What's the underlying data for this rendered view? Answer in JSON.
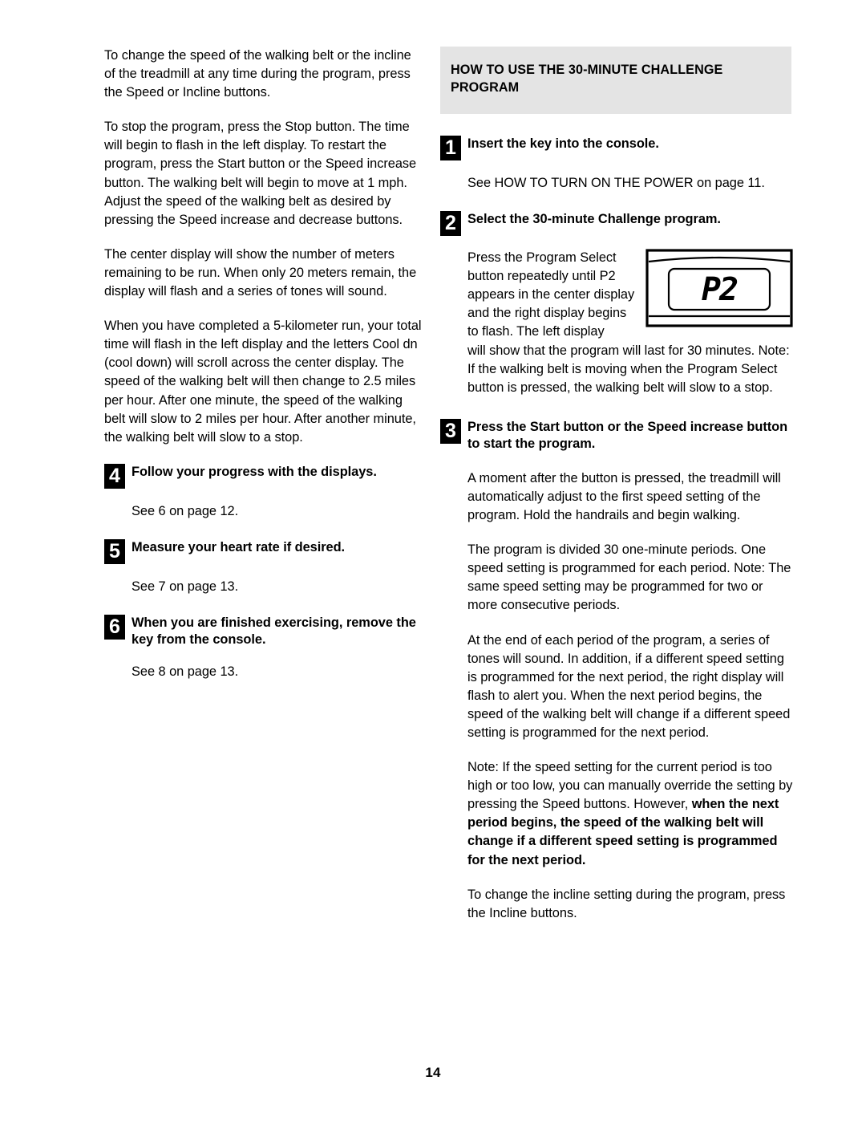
{
  "page": {
    "number": "14"
  },
  "left_column": {
    "paragraphs": [
      "To change the speed of the walking belt or the incline of the treadmill at any time during the program, press the Speed or Incline buttons.",
      "To stop the program, press the Stop button. The time will begin to flash in the left display. To restart the program, press the Start button or the Speed increase button. The walking belt will begin to move at 1 mph. Adjust the speed of the walking belt as desired by pressing the Speed increase and decrease buttons.",
      "The center display will show the number of meters remaining to be run. When only 20 meters remain, the display will flash and a series of tones will sound.",
      "When you have completed a 5-kilometer run, your total time will flash in the left display and the letters  Cool dn  (cool down) will scroll across the center display. The speed of the walking belt will then change to 2.5 miles per hour. After one minute, the speed of the walking belt will slow to 2 miles per hour. After another minute, the walking belt will slow to a stop."
    ],
    "steps": [
      {
        "number": "4",
        "title": "Follow your progress with the displays.",
        "body": "See  6 on page 12."
      },
      {
        "number": "5",
        "title": "Measure your heart rate if desired.",
        "body": "See  7 on page 13."
      },
      {
        "number": "6",
        "title": "When you are finished exercising, remove the key from the console.",
        "body": "See  8 on page 13."
      }
    ]
  },
  "right_column": {
    "section_heading": "HOW TO USE THE 30-MINUTE CHALLENGE PROGRAM",
    "step1": {
      "number": "1",
      "title": "Insert the key into the console.",
      "body": "See HOW TO TURN ON THE POWER on page 11."
    },
    "step2": {
      "number": "2",
      "title": "Select the 30-minute Challenge program.",
      "body_narrow": "Press the Program Select button repeatedly until P2 appears in the center display and the right display begins to flash. The left display",
      "body_rest": "will show that the program will last for 30 minutes. Note: If the walking belt is moving when the Program Select button is pressed, the walking belt will slow to a stop."
    },
    "console_figure": {
      "display_value": "P2"
    },
    "step3": {
      "number": "3",
      "title": "Press the Start button or the Speed increase button to start the program.",
      "paragraphs": [
        "A moment after the button is pressed, the treadmill will automatically adjust to the first speed setting of the program. Hold the handrails and begin walking.",
        "The program is divided 30 one-minute periods. One speed setting is programmed for each period. Note: The same speed setting may be programmed for two or more consecutive periods.",
        "At the end of each period of the program, a series of tones will sound. In addition, if a different speed setting is programmed for the next period, the right display will flash to alert you. When the next period begins, the speed of the walking belt will change if a different speed setting is programmed for the next period.",
        "To change the incline setting during the program, press the Incline buttons."
      ],
      "note_plain": "Note: If the speed setting for the current period is too high or too low, you can manually override the setting by pressing the Speed buttons. However, ",
      "note_bold": "when the next period begins, the speed of the walking belt will change if a different speed setting is programmed for the next period."
    }
  }
}
